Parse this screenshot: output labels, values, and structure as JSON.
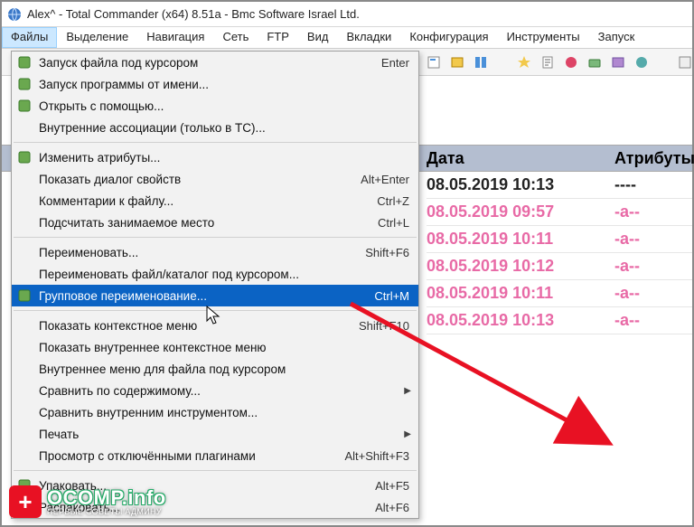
{
  "title": "Alex^ - Total Commander (x64) 8.51a - Bmc Software Israel Ltd.",
  "menubar": [
    "Файлы",
    "Выделение",
    "Навигация",
    "Сеть",
    "FTP",
    "Вид",
    "Вкладки",
    "Конфигурация",
    "Инструменты",
    "Запуск"
  ],
  "menubar_open_index": 0,
  "dropdown": {
    "groups": [
      [
        {
          "label": "Запуск файла под курсором",
          "shortcut": "Enter",
          "icon": "run-icon"
        },
        {
          "label": "Запуск программы от имени...",
          "icon": "run-as-icon"
        },
        {
          "label": "Открыть с помощью...",
          "icon": "open-with-icon"
        },
        {
          "label": "Внутренние ассоциации (только в TC)..."
        }
      ],
      [
        {
          "label": "Изменить атрибуты...",
          "icon": "attrib-icon"
        },
        {
          "label": "Показать диалог свойств",
          "shortcut": "Alt+Enter"
        },
        {
          "label": "Комментарии к файлу...",
          "shortcut": "Ctrl+Z"
        },
        {
          "label": "Подсчитать занимаемое место",
          "shortcut": "Ctrl+L"
        }
      ],
      [
        {
          "label": "Переименовать...",
          "shortcut": "Shift+F6"
        },
        {
          "label": "Переименовать файл/каталог под курсором..."
        },
        {
          "label": "Групповое переименование...",
          "shortcut": "Ctrl+M",
          "icon": "multi-rename-icon",
          "highlighted": true
        }
      ],
      [
        {
          "label": "Показать контекстное меню",
          "shortcut": "Shift+F10"
        },
        {
          "label": "Показать внутреннее контекстное меню"
        },
        {
          "label": "Внутреннее меню для файла под курсором"
        },
        {
          "label": "Сравнить по содержимому...",
          "submenu": true
        },
        {
          "label": "Сравнить внутренним инструментом..."
        },
        {
          "label": "Печать",
          "submenu": true
        },
        {
          "label": "Просмотр с отключёнными плагинами",
          "shortcut": "Alt+Shift+F3"
        }
      ],
      [
        {
          "label": "Упаковать...",
          "shortcut": "Alt+F5",
          "icon": "pack-icon"
        },
        {
          "label": "Распаковать...",
          "shortcut": "Alt+F6",
          "icon": "unpack-icon"
        }
      ]
    ]
  },
  "columns": {
    "date": "Дата",
    "attr": "Атрибуты"
  },
  "rows": [
    {
      "date": "08.05.2019 10:13",
      "attr": "----",
      "selected": false
    },
    {
      "date": "08.05.2019 09:57",
      "attr": "-a--",
      "selected": true
    },
    {
      "date": "08.05.2019 10:11",
      "attr": "-a--",
      "selected": true
    },
    {
      "date": "08.05.2019 10:12",
      "attr": "-a--",
      "selected": true
    },
    {
      "date": "08.05.2019 10:11",
      "attr": "-a--",
      "selected": true
    },
    {
      "date": "08.05.2019 10:13",
      "attr": "-a--",
      "selected": true
    }
  ],
  "watermark": {
    "brand": "OCOMP.info",
    "tagline": "ПЕРВЫЕ СОВЕТЫ АДМИНУ",
    "plus": "+"
  }
}
